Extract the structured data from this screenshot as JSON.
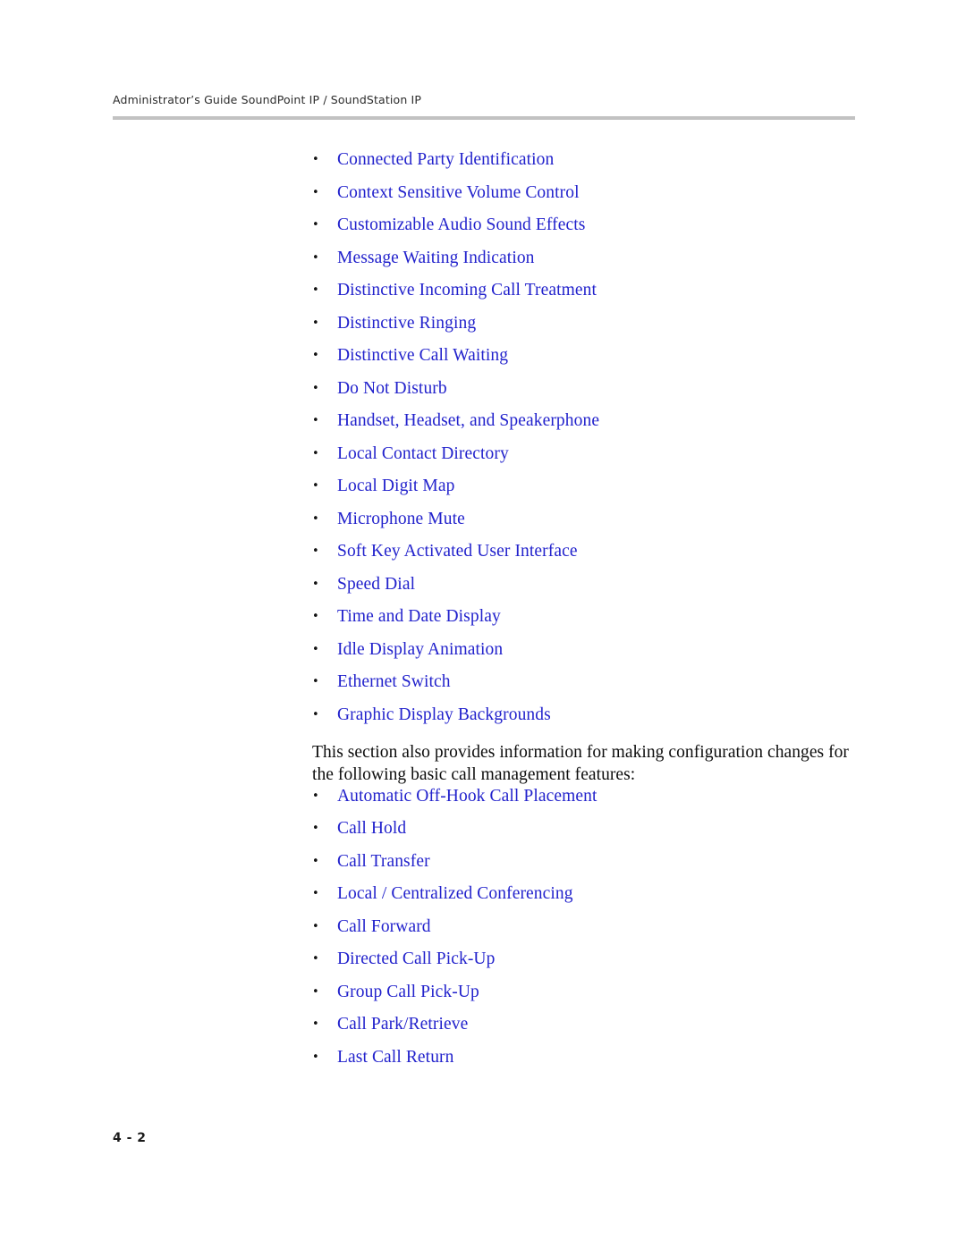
{
  "header": {
    "running_head": "Administrator’s Guide SoundPoint IP / SoundStation IP"
  },
  "bullet_glyph": "•",
  "feature_list": [
    {
      "label": "Connected Party Identification"
    },
    {
      "label": "Context Sensitive Volume Control"
    },
    {
      "label": "Customizable Audio Sound Effects"
    },
    {
      "label": "Message Waiting Indication"
    },
    {
      "label": "Distinctive Incoming Call Treatment"
    },
    {
      "label": "Distinctive Ringing"
    },
    {
      "label": "Distinctive Call Waiting"
    },
    {
      "label": "Do Not Disturb"
    },
    {
      "label": "Handset, Headset, and Speakerphone"
    },
    {
      "label": "Local Contact Directory"
    },
    {
      "label": "Local Digit Map"
    },
    {
      "label": "Microphone Mute"
    },
    {
      "label": "Soft Key Activated User Interface"
    },
    {
      "label": "Speed Dial"
    },
    {
      "label": "Time and Date Display"
    },
    {
      "label": "Idle Display Animation"
    },
    {
      "label": "Ethernet Switch"
    },
    {
      "label": "Graphic Display Backgrounds"
    }
  ],
  "paragraph": "This section also provides information for making configuration changes for the following basic call management features:",
  "call_management_list": [
    {
      "label": "Automatic Off-Hook Call Placement"
    },
    {
      "label": "Call Hold"
    },
    {
      "label": "Call Transfer"
    },
    {
      "label": "Local / Centralized Conferencing"
    },
    {
      "label": "Call Forward"
    },
    {
      "label": "Directed Call Pick-Up"
    },
    {
      "label": "Group Call Pick-Up"
    },
    {
      "label": "Call Park/Retrieve"
    },
    {
      "label": "Last Call Return"
    }
  ],
  "footer": {
    "page_number": "4 - 2"
  },
  "colors": {
    "link": "#2222cc",
    "rule": "#c2c2c2",
    "header_text": "#2b2b2b",
    "body_text": "#0d0d0d",
    "background": "#ffffff"
  }
}
